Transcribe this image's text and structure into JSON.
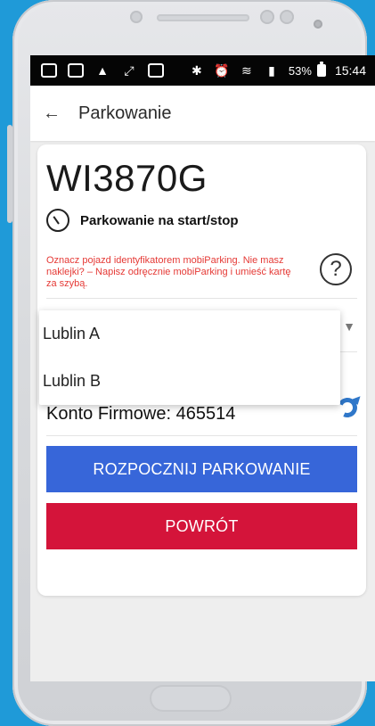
{
  "statusbar": {
    "battery_percent": "53%",
    "time": "15:44"
  },
  "appbar": {
    "title": "Parkowanie"
  },
  "card": {
    "plate": "WI3870G",
    "mode_label": "Parkowanie na start/stop",
    "warning_text": "Oznacz pojazd identyfikatorem mobiParking. Nie masz naklejki? – Napisz odręcznie mobiParking i umieść kartę za szybą.",
    "account_text": "Konto Firmowe: 465514",
    "start_button": "ROZPOCZNIJ PARKOWANIE",
    "back_button": "POWRÓT"
  },
  "dropdown": {
    "options": [
      "Lublin A",
      "Lublin B"
    ]
  }
}
